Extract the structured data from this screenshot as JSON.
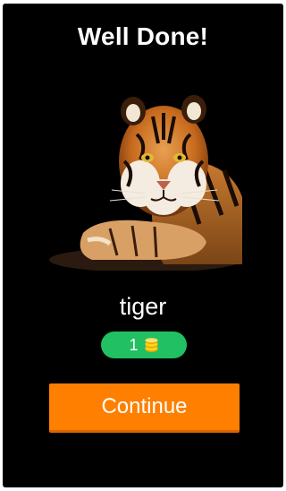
{
  "header": {
    "title": "Well Done!"
  },
  "result": {
    "image_icon": "tiger-photo",
    "answer": "tiger",
    "reward_count": "1",
    "reward_icon": "coins-icon"
  },
  "actions": {
    "continue_label": "Continue"
  },
  "colors": {
    "background": "#000000",
    "reward_badge": "#21c063",
    "coin": "#ffd21f",
    "continue_button": "#ff7f00"
  }
}
